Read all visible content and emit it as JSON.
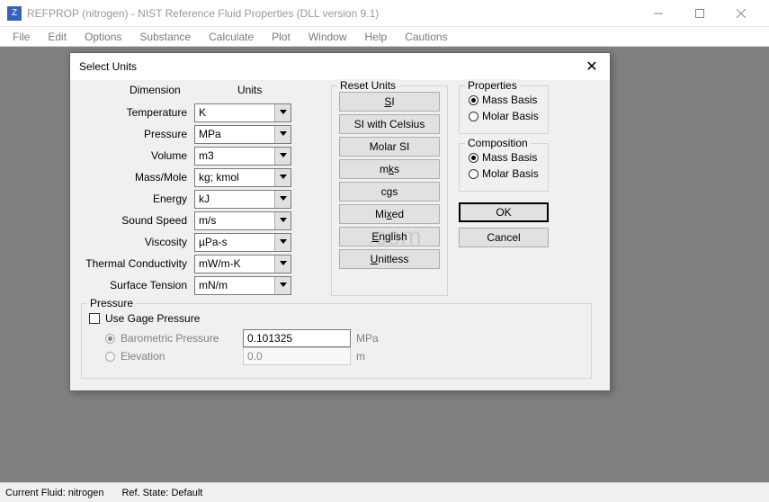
{
  "titlebar": {
    "icon_letter": "Z",
    "text": "REFPROP (nitrogen) - NIST Reference Fluid Properties (DLL version 9.1)"
  },
  "menubar": [
    "File",
    "Edit",
    "Options",
    "Substance",
    "Calculate",
    "Plot",
    "Window",
    "Help",
    "Cautions"
  ],
  "dialog": {
    "title": "Select Units",
    "headers": {
      "dimension": "Dimension",
      "units": "Units"
    },
    "rows": [
      {
        "label": "Temperature",
        "value": "K"
      },
      {
        "label": "Pressure",
        "value": "MPa"
      },
      {
        "label": "Volume",
        "value": "m3"
      },
      {
        "label": "Mass/Mole",
        "value": "kg; kmol"
      },
      {
        "label": "Energy",
        "value": "kJ"
      },
      {
        "label": "Sound Speed",
        "value": "m/s"
      },
      {
        "label": "Viscosity",
        "value": "µPa-s"
      },
      {
        "label": "Thermal Conductivity",
        "value": "mW/m-K"
      },
      {
        "label": "Surface Tension",
        "value": "mN/m"
      }
    ],
    "reset": {
      "legend": "Reset Units",
      "buttons": [
        "SI",
        "SI with Celsius",
        "Molar SI",
        "mks",
        "cgs",
        "Mixed",
        "English",
        "Unitless"
      ]
    },
    "properties": {
      "legend": "Properties",
      "options": [
        "Mass Basis",
        "Molar Basis"
      ],
      "selected": 0
    },
    "composition": {
      "legend": "Composition",
      "options": [
        "Mass Basis",
        "Molar Basis"
      ],
      "selected": 0
    },
    "ok_label": "OK",
    "cancel_label": "Cancel",
    "pressure": {
      "legend": "Pressure",
      "use_gage": "Use Gage Pressure",
      "use_gage_checked": false,
      "barometric_label": "Barometric Pressure",
      "barometric_value": "0.101325",
      "barometric_unit": "MPa",
      "elevation_label": "Elevation",
      "elevation_value": "0.0",
      "elevation_unit": "m",
      "selected": 0
    }
  },
  "statusbar": {
    "fluid": "Current Fluid: nitrogen",
    "refstate": "Ref. State: Default"
  },
  "watermark": ".com"
}
